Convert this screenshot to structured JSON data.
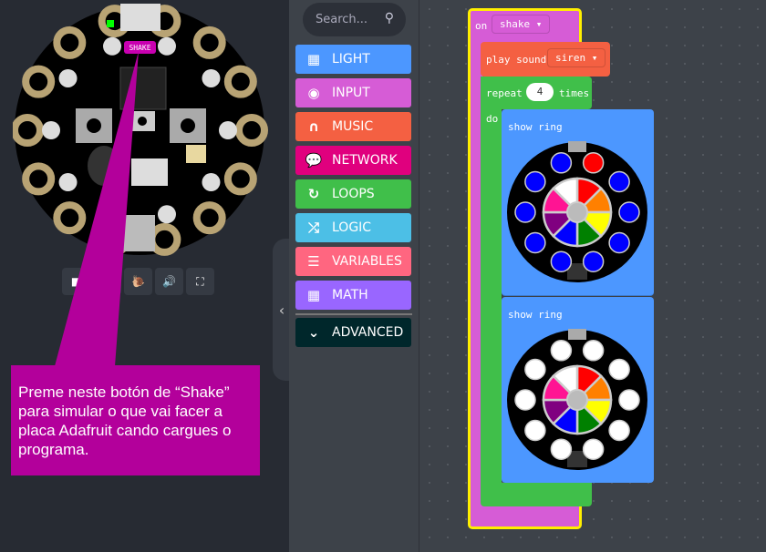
{
  "simulator": {
    "shake_button_label": "SHAKE",
    "controls": [
      {
        "name": "stop-button",
        "icon": "stop-icon",
        "glyph": "■"
      },
      {
        "name": "restart-button",
        "icon": "restart-icon",
        "glyph": "↻"
      },
      {
        "name": "slow-mo-button",
        "icon": "snail-icon",
        "glyph": "🐌"
      },
      {
        "name": "mute-button",
        "icon": "volume-icon",
        "glyph": "🔊"
      },
      {
        "name": "fullscreen-button",
        "icon": "fullscreen-icon",
        "glyph": "⛶"
      }
    ]
  },
  "toolbox": {
    "search_placeholder": "Search...",
    "categories": [
      {
        "label": "LIGHT",
        "color": "#4c97ff",
        "icon": "grid-icon",
        "glyph": "▦"
      },
      {
        "label": "INPUT",
        "color": "#d65cd6",
        "icon": "target-icon",
        "glyph": "◉"
      },
      {
        "label": "MUSIC",
        "color": "#f46042",
        "icon": "headphones-icon",
        "glyph": "∩"
      },
      {
        "label": "NETWORK",
        "color": "#e0007e",
        "icon": "chat-icon",
        "glyph": "💬"
      },
      {
        "label": "LOOPS",
        "color": "#40bf4a",
        "icon": "refresh-icon",
        "glyph": "↻"
      },
      {
        "label": "LOGIC",
        "color": "#4cbfe6",
        "icon": "shuffle-icon",
        "glyph": "⤮"
      },
      {
        "label": "VARIABLES",
        "color": "#ff6680",
        "icon": "list-icon",
        "glyph": "☰"
      },
      {
        "label": "MATH",
        "color": "#9966ff",
        "icon": "calculator-icon",
        "glyph": "▦"
      }
    ],
    "advanced": {
      "label": "ADVANCED",
      "color": "#00272b",
      "glyph": "⌄"
    }
  },
  "blocks": {
    "on": {
      "label": "on",
      "event": "shake",
      "color": "#d65cd6"
    },
    "play_sound": {
      "label": "play sound",
      "sound": "siren",
      "color": "#f46042"
    },
    "repeat": {
      "label": "repeat",
      "count": "4",
      "times": "times",
      "do": "do",
      "color": "#40bf4a"
    },
    "show_ring_1": {
      "label": "show ring",
      "color": "#4c97ff",
      "leds": [
        "#ff0000",
        "#0000ff",
        "#0000ff",
        "#0000ff",
        "#0000ff",
        "#0000ff",
        "#0000ff",
        "#0000ff",
        "#0000ff",
        "#0000ff"
      ]
    },
    "show_ring_2": {
      "label": "show ring",
      "color": "#4c97ff",
      "leds": [
        "#ffffff",
        "#ffffff",
        "#ffffff",
        "#ffffff",
        "#ffffff",
        "#ffffff",
        "#ffffff",
        "#ffffff",
        "#ffffff",
        "#ffffff"
      ]
    },
    "palette": [
      "#ff0000",
      "#ff8000",
      "#ffff00",
      "#008000",
      "#0000ff",
      "#800080",
      "#ff1493",
      "#ffffff"
    ]
  },
  "callout": {
    "text": "Preme neste botón de “Shake” para simular o que vai facer a placa Adafruit cando cargues o programa.",
    "color": "#b3009b"
  }
}
